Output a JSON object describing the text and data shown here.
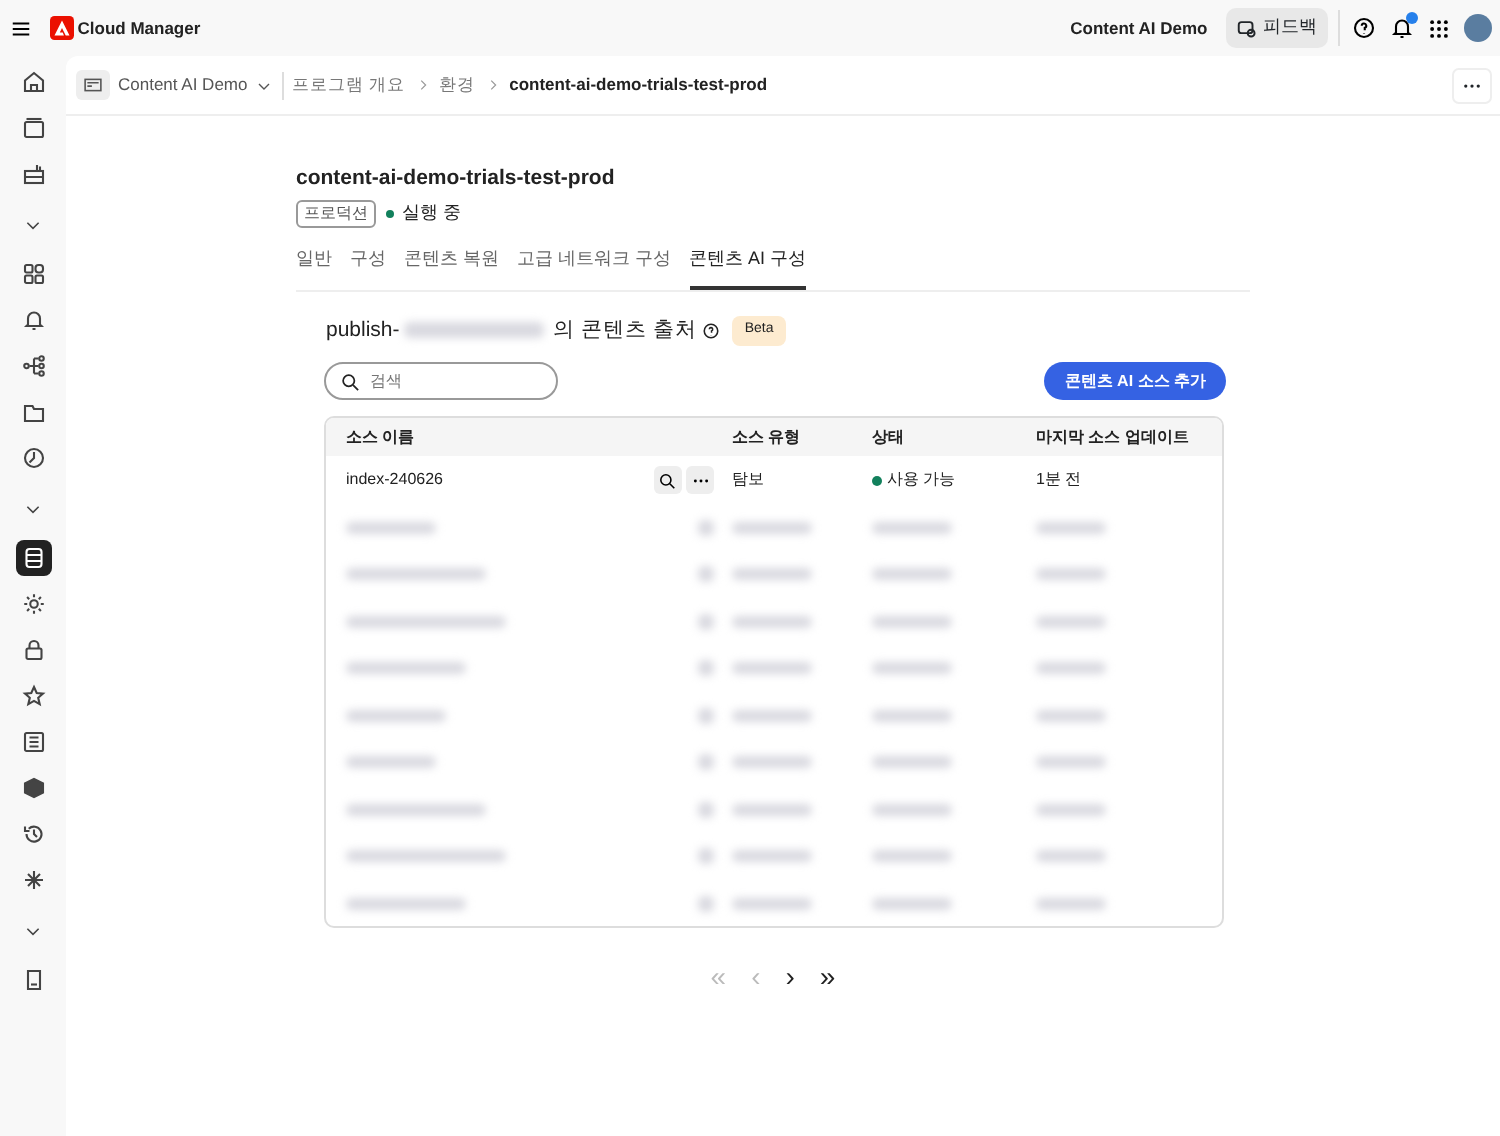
{
  "app": {
    "name": "Cloud Manager",
    "org": "Content AI Demo",
    "feedback": "피드백",
    "notifications_unread": true
  },
  "sidebar": [
    {
      "kind": "icon",
      "selected": false
    },
    {
      "kind": "icon",
      "selected": false
    },
    {
      "kind": "icon",
      "selected": false
    },
    {
      "kind": "toggle",
      "expanded": true
    },
    {
      "kind": "icon",
      "selected": false
    },
    {
      "kind": "icon",
      "selected": false
    },
    {
      "kind": "icon",
      "selected": false
    },
    {
      "kind": "icon",
      "selected": false
    },
    {
      "kind": "icon",
      "selected": false
    },
    {
      "kind": "toggle",
      "expanded": true
    },
    {
      "kind": "icon",
      "selected": true
    },
    {
      "kind": "icon",
      "selected": false
    },
    {
      "kind": "icon",
      "selected": false
    },
    {
      "kind": "icon",
      "selected": false
    },
    {
      "kind": "icon",
      "selected": false
    },
    {
      "kind": "icon",
      "selected": false
    },
    {
      "kind": "icon",
      "selected": false
    },
    {
      "kind": "icon",
      "selected": false
    },
    {
      "kind": "toggle",
      "expanded": true
    },
    {
      "kind": "icon",
      "selected": false
    }
  ],
  "breadcrumb": {
    "program": "Content AI Demo",
    "items": [
      "프로그램 개요",
      "환경",
      "content-ai-demo-trials-test-prod"
    ]
  },
  "environment": {
    "title": "content-ai-demo-trials-test-prod",
    "tag": "프로덕션",
    "status": "실행 중"
  },
  "tabs": [
    {
      "label": "일반",
      "selected": false
    },
    {
      "label": "구성",
      "selected": false
    },
    {
      "label": "콘텐츠 복원",
      "selected": false
    },
    {
      "label": "고급 네트워크 구성",
      "selected": false
    },
    {
      "label": "콘텐츠 AI 구성",
      "selected": true
    }
  ],
  "section": {
    "prefix": "publish-",
    "suffix": "의 콘텐츠 출처",
    "badge": "Beta"
  },
  "search": {
    "placeholder": "검색"
  },
  "add_button": "콘텐츠 AI 소스 추가",
  "table": {
    "columns": [
      "소스 이름",
      "소스 유형",
      "상태",
      "마지막 소스 업데이트"
    ],
    "rows": [
      {
        "name": "index-240626",
        "type": "탐보",
        "status": "사용 가능",
        "updated": "1분 전"
      }
    ],
    "hidden_rows": [
      {
        "kind": "blurred"
      },
      {
        "kind": "blurred"
      },
      {
        "kind": "blurred"
      },
      {
        "kind": "blurred"
      },
      {
        "kind": "blurred"
      },
      {
        "kind": "blurred"
      },
      {
        "kind": "blurred"
      },
      {
        "kind": "blurred"
      },
      {
        "kind": "blurred"
      }
    ]
  },
  "pagination": [
    {
      "label": "«",
      "disabled": true
    },
    {
      "label": "‹",
      "disabled": true
    },
    {
      "label": "›",
      "disabled": false
    },
    {
      "label": "»",
      "disabled": false
    }
  ]
}
